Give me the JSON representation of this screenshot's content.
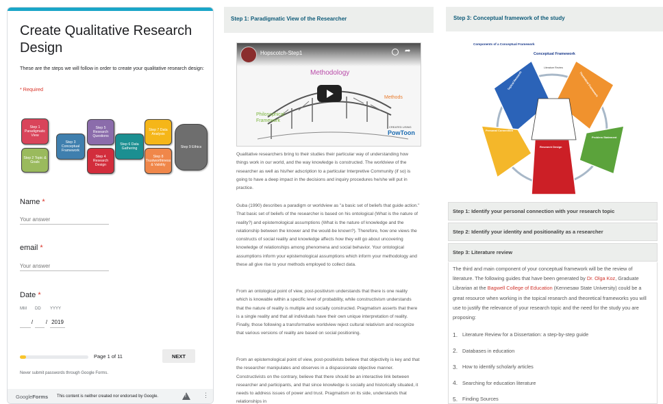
{
  "form": {
    "title_line1": "Create Qualitative Research",
    "title_line2": "Design",
    "description": "These are the steps we will follow in order to create your qualitative research design:",
    "required_note": "* Required",
    "steps": [
      {
        "label": "Step 1 Paradigmatic View",
        "color": "#d9445a"
      },
      {
        "label": "Step 2 Topic & Goals",
        "color": "#9aba5d"
      },
      {
        "label": "Step 3 Conceptual Framework",
        "color": "#3f7fae"
      },
      {
        "label": "Step 5 Research Questions",
        "color": "#8b6cab"
      },
      {
        "label": "Step 4 Research Design",
        "color": "#d22d3c"
      },
      {
        "label": "Step 6 Data Gathering",
        "color": "#1b8f91"
      },
      {
        "label": "Step 7 Data Analysis",
        "color": "#f5b619"
      },
      {
        "label": "Step 8 Trustworthiness & Validity",
        "color": "#f0874a"
      },
      {
        "label": "Step 9 Ethics",
        "color": "#6e6e6e"
      }
    ],
    "questions": {
      "name_label": "Name",
      "name_placeholder": "Your answer",
      "email_label": "email",
      "email_placeholder": "Your answer",
      "date_label": "Date",
      "date_mm": "MM",
      "date_dd": "DD",
      "date_yyyy": "YYYY",
      "date_sep": "/",
      "date_year": "2019",
      "required_mark": "*"
    },
    "progress": {
      "fraction": 0.09,
      "text": "Page 1 of 11"
    },
    "next_label": "NEXT",
    "password_warning": "Never submit passwords through Google Forms.",
    "footer": {
      "logo_google": "Google",
      "logo_forms": "Forms",
      "disclaimer": "This content is neither created nor endorsed by Google.",
      "warn_icon": "warning-icon",
      "more_icon": "more-vert-icon"
    }
  },
  "step1": {
    "header": "Step 1: Paradigmatic View of the Researcher",
    "video": {
      "title": "Hopscotch-Step1",
      "label_methodology": "Methodology",
      "label_methods": "Methods",
      "label_philosophical": "Philosophical Framework",
      "watermark_line1": "CREATED USING",
      "watermark_line2": "PowToon"
    },
    "paragraphs": [
      "Qualitative researchers bring to their studies their particular way of understanding how things work in our world, and the way knowledge is constructed. The worldview of the researcher as well as his/her adscription to a particular Interpretive Community (if so) is going to have a deep impact in the decisions and inquiry procedures he/she will put in practice.",
      "Guba (1990) describes a paradigm or worldview as \"a basic set of beliefs that guide action.\" That basic set of beliefs of the researcher is based on his ontological (What is the nature of reality?) and epistemological assumptions (What is the nature of knowledge and the relationship between the knower and the would-be known?). Therefore, how one views the constructs of social reality and knowledge affects how they will go about uncovering knowledge of relationships among phenomena and social behavior. Your ontological assumptions inform your epistemological assumptions which inform your methodology and these all give rise to your methods employed to collect data.",
      "From an ontological point of view, post-positivism understands that there is one reality which is knowable within a specific level of probability, while constructivism understands that the nature of reality is multiple and socially constructed. Pragmatism asserts that there is a single reality and that all individuals have their own unique interpretation of reality. Finally, those following a transformative worldview reject cultural relativism and recognize that various versions of reality are based on social positioning.",
      "From an epistemological point of view, post-positivists believe that objectivity is key and that the researcher manipulates and observes in a dispassionate objective manner. Constructivists on the contrary, believe that there should be an interactive link between researcher and participants, and that since knowledge is socially and historically situated, it needs to address issues of power and trust. Pragmatism on its side, understands that relationships in"
    ]
  },
  "step3": {
    "header": "Step 3: Conceptual framework of the study",
    "diagram": {
      "title": "Components of a Conceptual Framework",
      "center_label": "Conceptual Framework",
      "lit_review_label": "Literature Review",
      "segments": [
        {
          "title": "Topical Research",
          "color": "#2b63b8"
        },
        {
          "title": "Theoretical Framework",
          "color": "#f0922e"
        },
        {
          "title": "Problem Statement",
          "color": "#5ba33b"
        },
        {
          "title": "Research Design",
          "color": "#cc1f26"
        },
        {
          "title": "Personal Connection",
          "color": "#f4b72a"
        }
      ]
    },
    "accordion": [
      {
        "label": "Step 1: Identify your personal connection with your research topic"
      },
      {
        "label": "Step 2: Identify your identity and positionality as a researcher"
      },
      {
        "label": "Step 3: Literature review"
      }
    ],
    "lit_review": {
      "p1": "The third and main component of your conceptual framework will be the review of literature. The following  guides that have been generated by",
      "author": "Dr. Olga Koz",
      "p2": ", Graduate Librarian at the",
      "college": "Bagwell College of Education",
      "p3": "(Kennesaw State University) could be a great resource when working in the topical research and theoretical frameworks you will use to justify the relevance of your research topic and the need for the study you are proposing:",
      "items": [
        {
          "num": "1.",
          "text": "Literature Review for a Dissertation: a step-by-step guide"
        },
        {
          "num": "2.",
          "text": "Databases in education"
        },
        {
          "num": "3.",
          "text": "How to identify scholarly articles"
        },
        {
          "num": "4.",
          "text": "Searching for education literature"
        },
        {
          "num": "5.",
          "text": "Finding Sources"
        }
      ]
    }
  }
}
